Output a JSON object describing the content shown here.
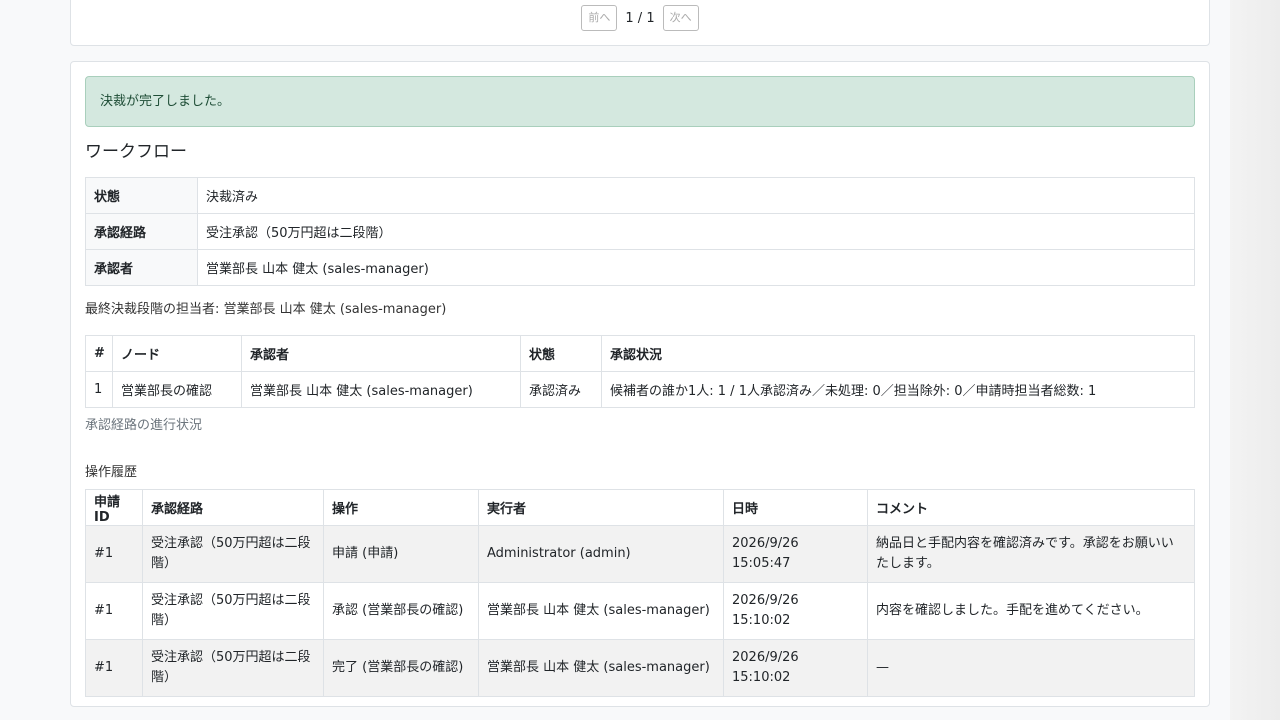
{
  "pager": {
    "prev_label": "前へ",
    "page_info": "1 / 1",
    "next_label": "次へ"
  },
  "alert": {
    "message": "決裁が完了しました。"
  },
  "workflow": {
    "title": "ワークフロー",
    "rows": [
      {
        "label": "状態",
        "value": "決裁済み"
      },
      {
        "label": "承認経路",
        "value": "受注承認（50万円超は二段階）"
      },
      {
        "label": "承認者",
        "value": "営業部長 山本 健太 (sales-manager)"
      }
    ],
    "final_assignee": "最終決裁段階の担当者: 営業部長 山本 健太 (sales-manager)"
  },
  "nodes": {
    "headers": [
      "#",
      "ノード",
      "承認者",
      "状態",
      "承認状況"
    ],
    "rows": [
      [
        "1",
        "営業部長の確認",
        "営業部長 山本 健太 (sales-manager)",
        "承認済み",
        "候補者の誰か1人: 1 / 1人承認済み／未処理: 0／担当除外: 0／申請時担当者総数: 1"
      ]
    ],
    "progress_label": "承認経路の進行状況"
  },
  "history": {
    "title": "操作履歴",
    "headers": [
      "申請ID",
      "承認経路",
      "操作",
      "実行者",
      "日時",
      "コメント"
    ],
    "rows": [
      [
        "#1",
        "受注承認（50万円超は二段階）",
        "申請 (申請)",
        "Administrator (admin)",
        "2026/9/26 15:05:47",
        "納品日と手配内容を確認済みです。承認をお願いいたします。"
      ],
      [
        "#1",
        "受注承認（50万円超は二段階）",
        "承認 (営業部長の確認)",
        "営業部長 山本 健太 (sales-manager)",
        "2026/9/26 15:10:02",
        "内容を確認しました。手配を進めてください。"
      ],
      [
        "#1",
        "受注承認（50万円超は二段階）",
        "完了 (営業部長の確認)",
        "営業部長 山本 健太 (sales-manager)",
        "2026/9/26 15:10:02",
        "—"
      ]
    ]
  }
}
